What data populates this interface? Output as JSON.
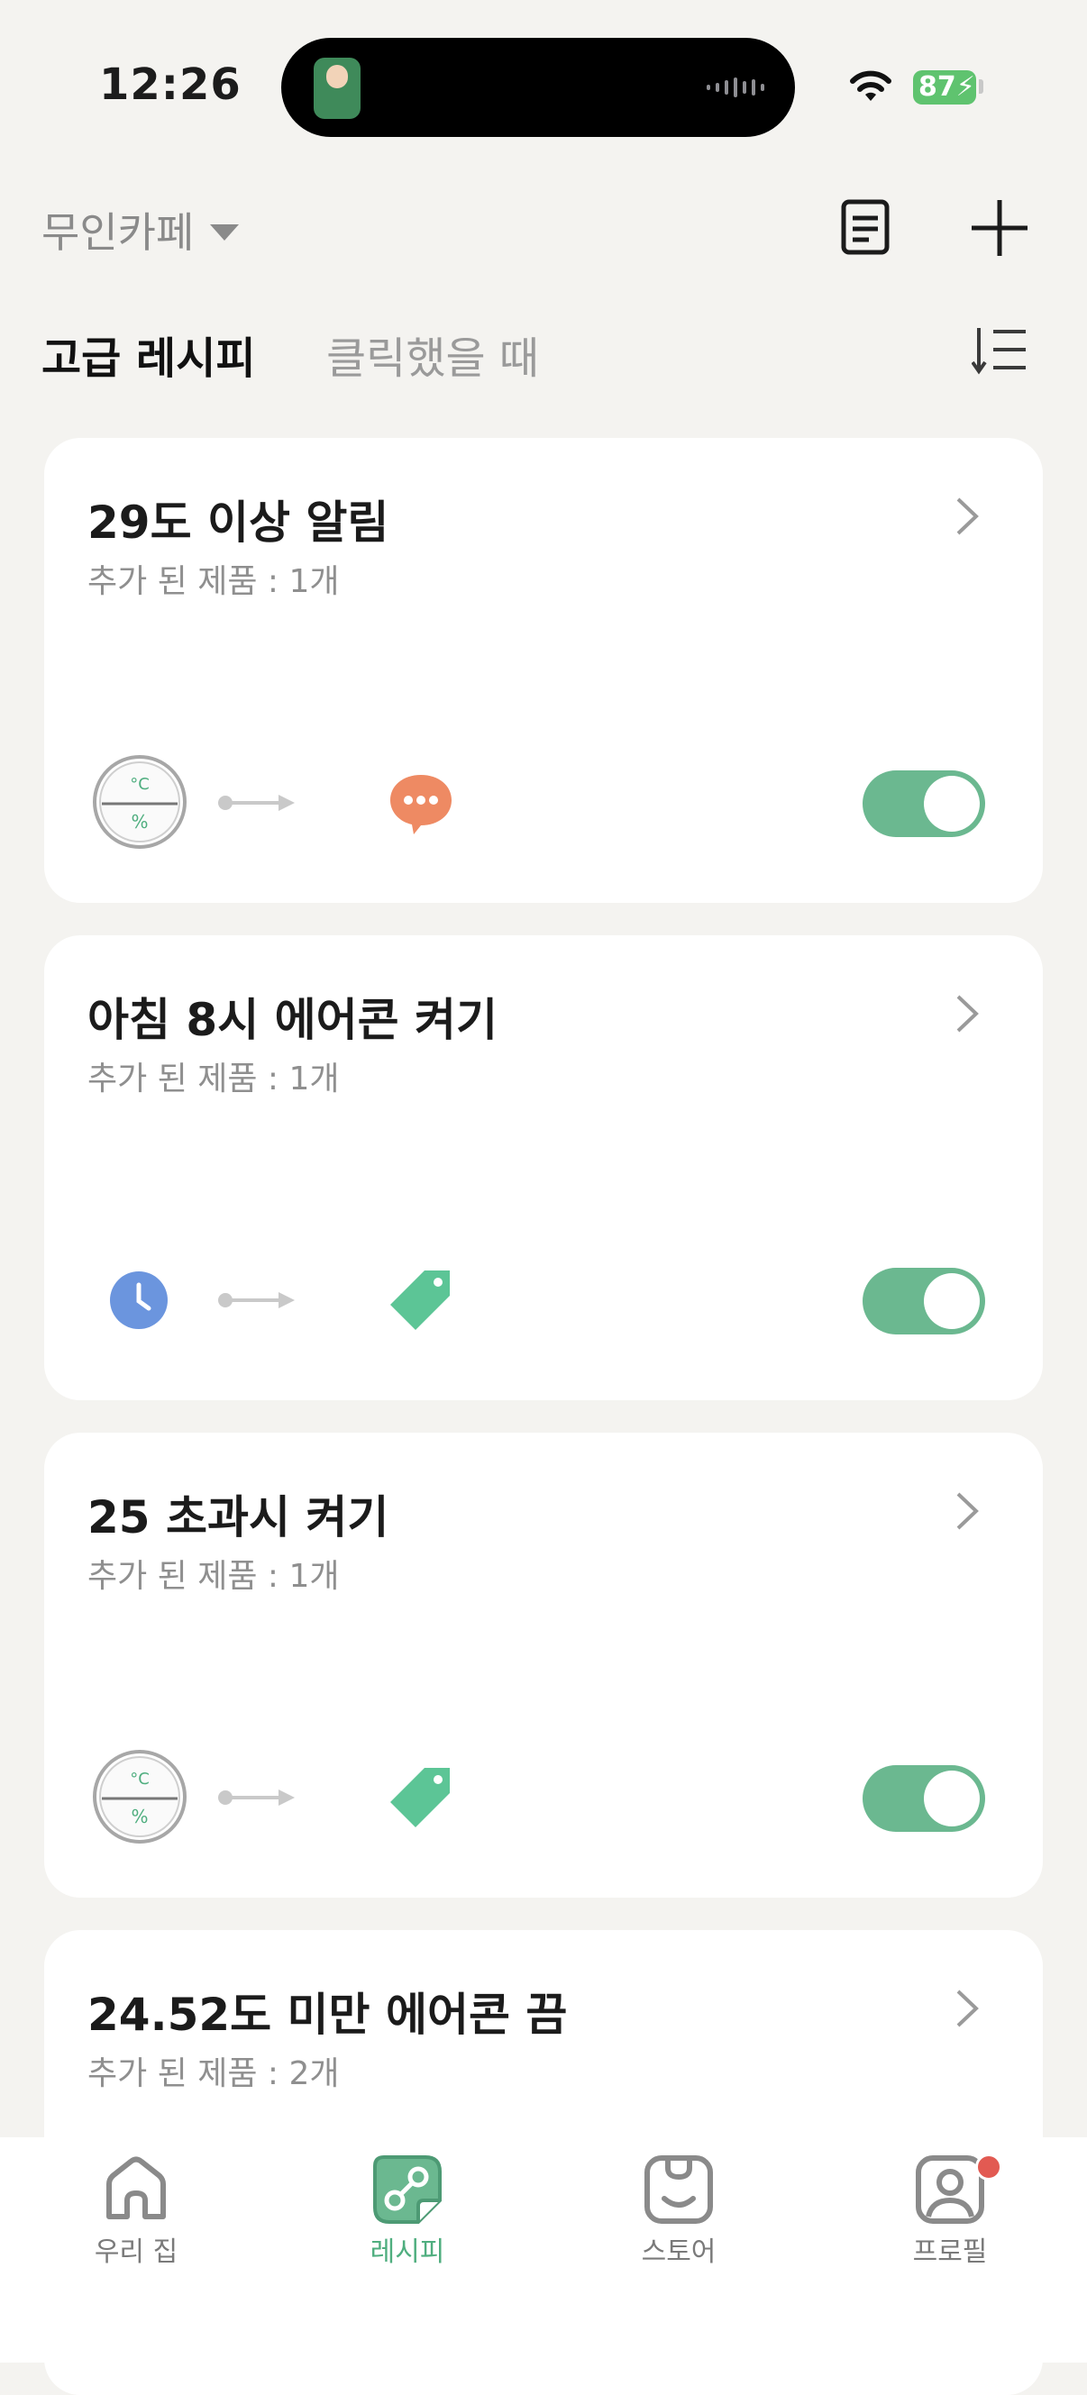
{
  "status_bar": {
    "time": "12:26",
    "battery": "87"
  },
  "header": {
    "home_name": "무인카페"
  },
  "tabs": [
    {
      "label": "고급 레시피"
    },
    {
      "label": "클릭했을 때"
    }
  ],
  "recipes": [
    {
      "title": "29도 이상 알림",
      "subtitle": "추가 된 제품 : 1개",
      "trigger": "thermo-hygrometer-icon",
      "action": "chat-bubble-icon",
      "enabled": true
    },
    {
      "title": "아침 8시 에어콘 켜기",
      "subtitle": "추가 된 제품 : 1개",
      "trigger": "clock-icon",
      "action": "tag-icon",
      "enabled": true
    },
    {
      "title": "25 초과시 켜기",
      "subtitle": "추가 된 제품 : 1개",
      "trigger": "thermo-hygrometer-icon",
      "action": "tag-icon",
      "enabled": true
    },
    {
      "title": "24.52도 미만 에어콘 끔",
      "subtitle": "추가 된 제품 : 2개"
    }
  ],
  "thermo_labels": {
    "top": "°C",
    "bottom": "%"
  },
  "bottom_nav": [
    {
      "label": "우리 집",
      "icon": "home-icon"
    },
    {
      "label": "레시피",
      "icon": "recipe-icon",
      "active": true
    },
    {
      "label": "스토어",
      "icon": "store-icon"
    },
    {
      "label": "프로필",
      "icon": "profile-icon"
    }
  ],
  "colors": {
    "accent": "#6bb890",
    "background": "#f4f3f0",
    "chat": "#ee8a63",
    "tag": "#5cc596",
    "clock": "#6b95de",
    "notification": "#e25a52"
  }
}
